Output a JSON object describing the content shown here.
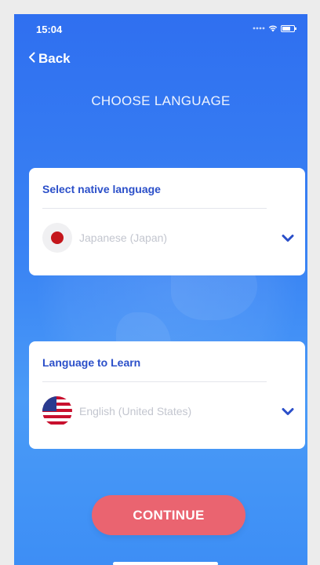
{
  "status_bar": {
    "time": "15:04",
    "signal_icon": "signal-dots-icon",
    "wifi_icon": "wifi-icon",
    "battery_icon": "battery-icon"
  },
  "nav": {
    "back_label": "Back",
    "back_icon": "chevron-left-icon"
  },
  "page": {
    "title": "CHOOSE LANGUAGE"
  },
  "native_card": {
    "label": "Select native language",
    "selected_language": "Japanese (Japan)",
    "flag_icon": "japan-flag-icon",
    "dropdown_icon": "chevron-down-icon"
  },
  "learn_card": {
    "label": "Language to Learn",
    "selected_language": "English (United States)",
    "flag_icon": "us-flag-icon",
    "dropdown_icon": "chevron-down-icon"
  },
  "actions": {
    "continue_label": "CONTINUE"
  },
  "colors": {
    "background_top": "#2f6ff0",
    "background_bottom": "#4a9bf7",
    "card_label": "#2b4fc9",
    "chevron": "#2b4fc9",
    "placeholder_text": "#c3c6cf",
    "continue_button": "#ea6470"
  }
}
